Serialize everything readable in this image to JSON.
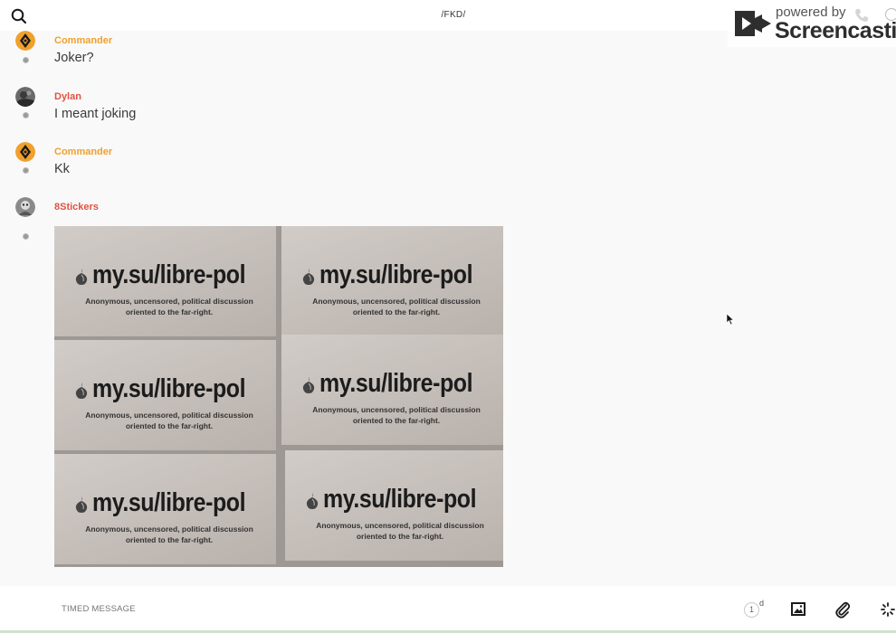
{
  "header": {
    "title": "/FKD/"
  },
  "watermark": {
    "powered_label": "powered by",
    "brand_name": "Screencastify"
  },
  "messages": [
    {
      "author": "Commander",
      "text": "Joker?",
      "author_color": "#f0a02c",
      "avatar": "commander-avatar"
    },
    {
      "author": "Dylan",
      "text": "I meant joking",
      "author_color": "#de5442",
      "avatar": "dylan-avatar"
    },
    {
      "author": "Commander",
      "text": "Kk",
      "author_color": "#f0a02c",
      "avatar": "commander-avatar"
    },
    {
      "author": "8Stickers",
      "text": "",
      "author_color": "#de5442",
      "avatar": "8stickers-avatar"
    }
  ],
  "image_attachment": {
    "stickers": [
      {
        "url": "my.su/libre-pol",
        "line1": "Anonymous, uncensored, political discussion",
        "line2": "oriented to the far-right."
      },
      {
        "url": "my.su/libre-pol",
        "line1": "Anonymous, uncensored, political discussion",
        "line2": "oriented to the far-right."
      },
      {
        "url": "my.su/libre-pol",
        "line1": "Anonymous, uncensored, political discussion",
        "line2": "oriented to the far-right."
      },
      {
        "url": "my.su/libre-pol",
        "line1": "Anonymous, uncensored, political discussion",
        "line2": "oriented to the far-right."
      },
      {
        "url": "my.su/libre-pol",
        "line1": "Anonymous, uncensored, political discussion",
        "line2": "oriented to the far-right."
      },
      {
        "url": "my.su/libre-pol",
        "line1": "Anonymous, uncensored, political discussion",
        "line2": "oriented to the far-right."
      }
    ]
  },
  "composer": {
    "placeholder": "TIMED MESSAGE",
    "timer_value": "1",
    "timer_unit": "d"
  },
  "icons": {
    "search": "search-icon",
    "image": "image-icon",
    "attach": "paperclip-icon",
    "more": "spinner-icon",
    "phone": "phone-icon",
    "info": "info-icon"
  },
  "colors": {
    "accent_orange": "#f0a02c",
    "accent_red": "#de5442"
  }
}
